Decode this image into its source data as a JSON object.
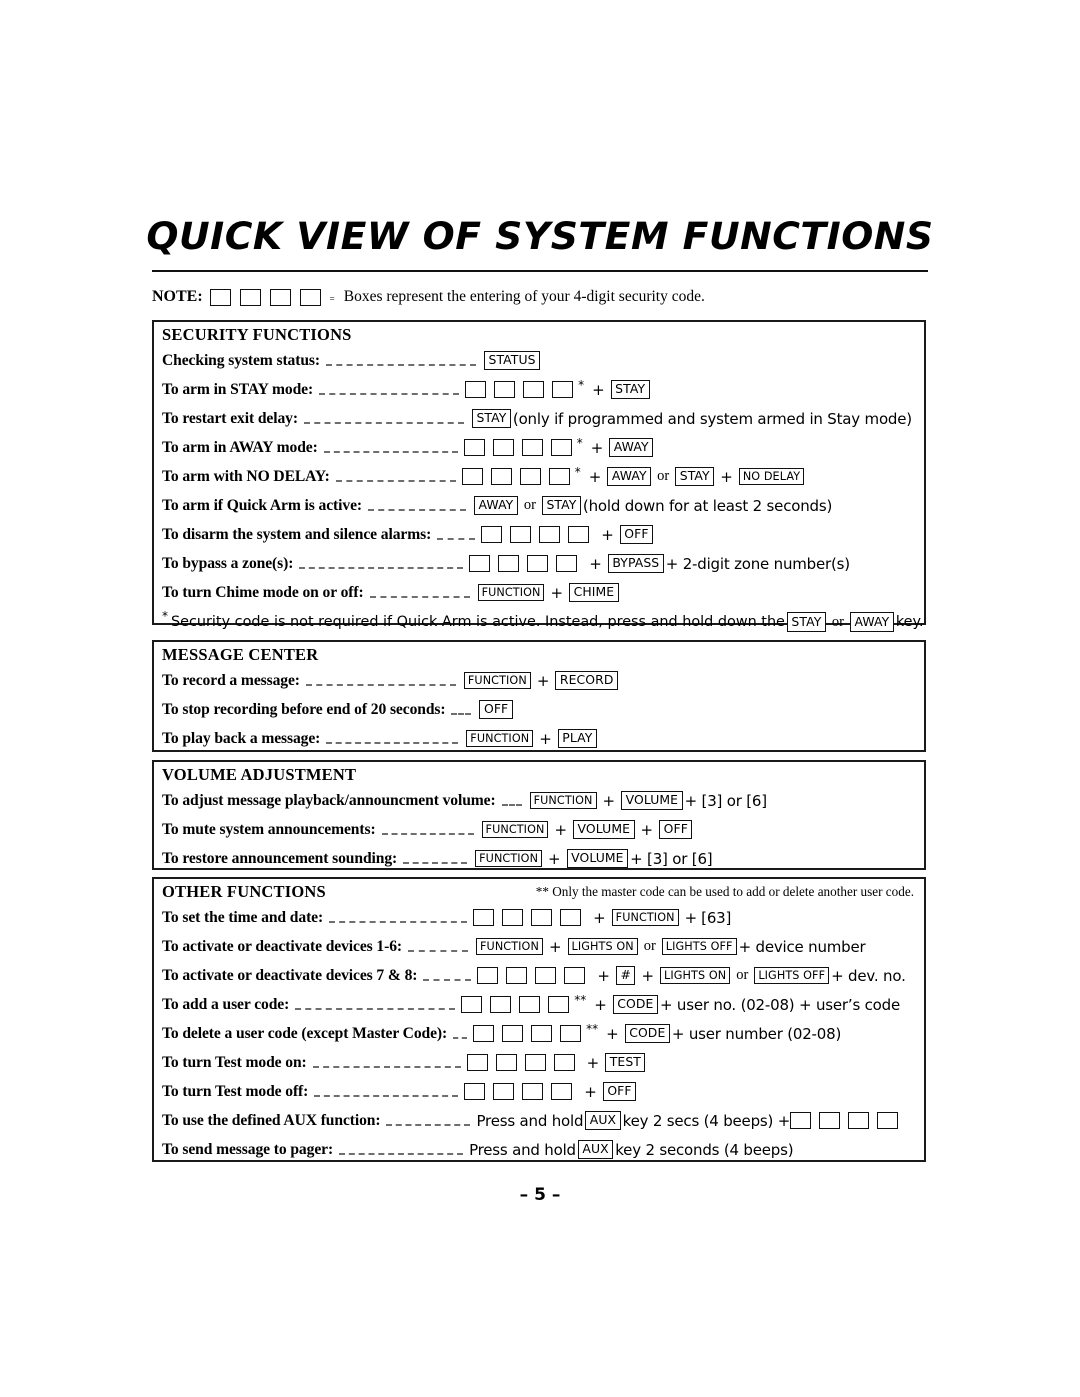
{
  "document": {
    "title": "QUICK VIEW OF SYSTEM FUNCTIONS",
    "page_number": "– 5 –"
  },
  "note": {
    "label": "NOTE:",
    "equals": "=",
    "text": "Boxes represent the entering of your 4-digit security code.",
    "box_count": 4
  },
  "sections": [
    {
      "heading": "SECURITY FUNCTIONS",
      "rows": [
        {
          "label": "Checking system status:",
          "leader": 150,
          "parts": [
            {
              "t": "key",
              "v": "STATUS"
            }
          ]
        },
        {
          "label": "To arm in STAY mode:",
          "leader": 140,
          "parts": [
            {
              "t": "code",
              "v": 4
            },
            {
              "t": "star",
              "v": "*"
            },
            {
              "t": "op",
              "v": "+"
            },
            {
              "t": "key",
              "v": "STAY"
            }
          ]
        },
        {
          "label": "To restart exit delay:",
          "leader": 160,
          "parts": [
            {
              "t": "key",
              "v": "STAY"
            },
            {
              "t": "plain",
              "v": "(only if programmed and system armed in Stay mode)"
            }
          ]
        },
        {
          "label": "To arm in AWAY mode:",
          "leader": 134,
          "parts": [
            {
              "t": "code",
              "v": 4
            },
            {
              "t": "star",
              "v": "*"
            },
            {
              "t": "op",
              "v": "+"
            },
            {
              "t": "key",
              "v": "AWAY"
            }
          ]
        },
        {
          "label": "To arm with NO DELAY:",
          "leader": 120,
          "parts": [
            {
              "t": "code",
              "v": 4
            },
            {
              "t": "star",
              "v": "*"
            },
            {
              "t": "op",
              "v": "+"
            },
            {
              "t": "key",
              "v": "AWAY"
            },
            {
              "t": "or",
              "v": "or"
            },
            {
              "t": "key",
              "v": "STAY"
            },
            {
              "t": "op",
              "v": "+"
            },
            {
              "t": "key",
              "v": "NO DELAY"
            }
          ]
        },
        {
          "label": "To arm if Quick Arm is active:",
          "leader": 98,
          "parts": [
            {
              "t": "key",
              "v": "AWAY"
            },
            {
              "t": "or",
              "v": "or"
            },
            {
              "t": "key",
              "v": "STAY"
            },
            {
              "t": "plain",
              "v": "(hold down for at least 2 seconds)"
            }
          ]
        },
        {
          "label": "To disarm the system and silence alarms:",
          "leader": 38,
          "parts": [
            {
              "t": "code",
              "v": 4
            },
            {
              "t": "op",
              "v": "+"
            },
            {
              "t": "key",
              "v": "OFF"
            }
          ]
        },
        {
          "label": "To bypass a zone(s):",
          "leader": 164,
          "parts": [
            {
              "t": "code",
              "v": 4
            },
            {
              "t": "op",
              "v": "+"
            },
            {
              "t": "key",
              "v": "BYPASS"
            },
            {
              "t": "plain",
              "v": "+ 2-digit zone number(s)"
            }
          ]
        },
        {
          "label": "To turn Chime mode on or off:",
          "leader": 100,
          "parts": [
            {
              "t": "key",
              "v": "FUNCTION"
            },
            {
              "t": "op",
              "v": "+"
            },
            {
              "t": "key",
              "v": "CHIME"
            }
          ]
        }
      ],
      "footnote": {
        "star": "*",
        "before": "Security code is not required if Quick Arm is active. Instead, press and hold down the",
        "key1": "STAY",
        "or": "or",
        "key2": "AWAY",
        "after": "key."
      }
    },
    {
      "heading": "MESSAGE CENTER",
      "rows": [
        {
          "label": "To record a message:",
          "leader": 150,
          "parts": [
            {
              "t": "key",
              "v": "FUNCTION"
            },
            {
              "t": "op",
              "v": "+"
            },
            {
              "t": "key",
              "v": "RECORD"
            }
          ]
        },
        {
          "label": "To stop recording before end of 20 seconds:",
          "leader": 20,
          "parts": [
            {
              "t": "key",
              "v": "OFF"
            }
          ]
        },
        {
          "label": "To play back a message:",
          "leader": 132,
          "parts": [
            {
              "t": "key",
              "v": "FUNCTION"
            },
            {
              "t": "op",
              "v": "+"
            },
            {
              "t": "key",
              "v": "PLAY"
            }
          ]
        }
      ]
    },
    {
      "heading": "VOLUME ADJUSTMENT",
      "rows": [
        {
          "label": "To adjust message playback/announcment volume:",
          "leader": 20,
          "parts": [
            {
              "t": "key",
              "v": "FUNCTION"
            },
            {
              "t": "op",
              "v": "+"
            },
            {
              "t": "key",
              "v": "VOLUME"
            },
            {
              "t": "plain",
              "v": "+ [3]  or [6]"
            }
          ]
        },
        {
          "label": "To mute system announcements:",
          "leader": 92,
          "parts": [
            {
              "t": "key",
              "v": "FUNCTION"
            },
            {
              "t": "op",
              "v": "+"
            },
            {
              "t": "key",
              "v": "VOLUME"
            },
            {
              "t": "op",
              "v": "+"
            },
            {
              "t": "key",
              "v": "OFF"
            }
          ]
        },
        {
          "label": "To restore announcement sounding:",
          "leader": 64,
          "parts": [
            {
              "t": "key",
              "v": "FUNCTION"
            },
            {
              "t": "op",
              "v": "+"
            },
            {
              "t": "key",
              "v": "VOLUME"
            },
            {
              "t": "plain",
              "v": "+ [3]  or [6]"
            }
          ]
        }
      ]
    },
    {
      "heading": "OTHER FUNCTIONS",
      "heading_note": "** Only the master code can be used to add or delete another user code.",
      "rows": [
        {
          "label": "To set the time and date:",
          "leader": 138,
          "parts": [
            {
              "t": "code",
              "v": 4
            },
            {
              "t": "op",
              "v": "+"
            },
            {
              "t": "key",
              "v": "FUNCTION"
            },
            {
              "t": "op",
              "v": "+"
            },
            {
              "t": "plain",
              "v": "[63]"
            }
          ]
        },
        {
          "label": "To activate or deactivate devices 1-6:",
          "leader": 60,
          "parts": [
            {
              "t": "key",
              "v": "FUNCTION"
            },
            {
              "t": "op",
              "v": "+"
            },
            {
              "t": "key",
              "v": "LIGHTS ON"
            },
            {
              "t": "or",
              "v": "or"
            },
            {
              "t": "key",
              "v": "LIGHTS OFF"
            },
            {
              "t": "plain",
              "v": "+ device number"
            }
          ]
        },
        {
          "label": "To activate or deactivate devices 7 & 8:",
          "leader": 48,
          "parts": [
            {
              "t": "code",
              "v": 4
            },
            {
              "t": "op",
              "v": "+"
            },
            {
              "t": "key",
              "v": "#"
            },
            {
              "t": "op",
              "v": "+"
            },
            {
              "t": "key",
              "v": "LIGHTS ON"
            },
            {
              "t": "or",
              "v": "or"
            },
            {
              "t": "key",
              "v": "LIGHTS OFF"
            },
            {
              "t": "plain",
              "v": "+ dev. no."
            }
          ]
        },
        {
          "label": "To add a user code:",
          "leader": 160,
          "parts": [
            {
              "t": "code",
              "v": 4
            },
            {
              "t": "star",
              "v": "**"
            },
            {
              "t": "op",
              "v": "+"
            },
            {
              "t": "key",
              "v": "CODE"
            },
            {
              "t": "plain",
              "v": "+ user no. (02-08) + user’s code"
            }
          ]
        },
        {
          "label": "To delete a user code (except Master Code):",
          "leader": 14,
          "parts": [
            {
              "t": "code",
              "v": 4
            },
            {
              "t": "star",
              "v": "**"
            },
            {
              "t": "op",
              "v": "+"
            },
            {
              "t": "key",
              "v": "CODE"
            },
            {
              "t": "plain",
              "v": "+  user number  (02-08)"
            }
          ]
        },
        {
          "label": "To turn Test mode on:",
          "leader": 148,
          "parts": [
            {
              "t": "code",
              "v": 4
            },
            {
              "t": "op",
              "v": "+"
            },
            {
              "t": "key",
              "v": "TEST"
            }
          ]
        },
        {
          "label": "To turn Test mode off:",
          "leader": 144,
          "parts": [
            {
              "t": "code",
              "v": 4
            },
            {
              "t": "op",
              "v": "+"
            },
            {
              "t": "key",
              "v": "OFF"
            }
          ]
        },
        {
          "label": "To use the defined AUX function:",
          "leader": 84,
          "parts": [
            {
              "t": "plain",
              "v": "Press and hold"
            },
            {
              "t": "key",
              "v": "AUX"
            },
            {
              "t": "plain",
              "v": "key 2 secs (4 beeps) +"
            },
            {
              "t": "code",
              "v": 4
            }
          ]
        },
        {
          "label": "To send message to pager:",
          "leader": 124,
          "parts": [
            {
              "t": "plain",
              "v": "Press and hold"
            },
            {
              "t": "key",
              "v": "AUX"
            },
            {
              "t": "plain",
              "v": "key 2 seconds (4 beeps)"
            }
          ]
        }
      ]
    }
  ]
}
